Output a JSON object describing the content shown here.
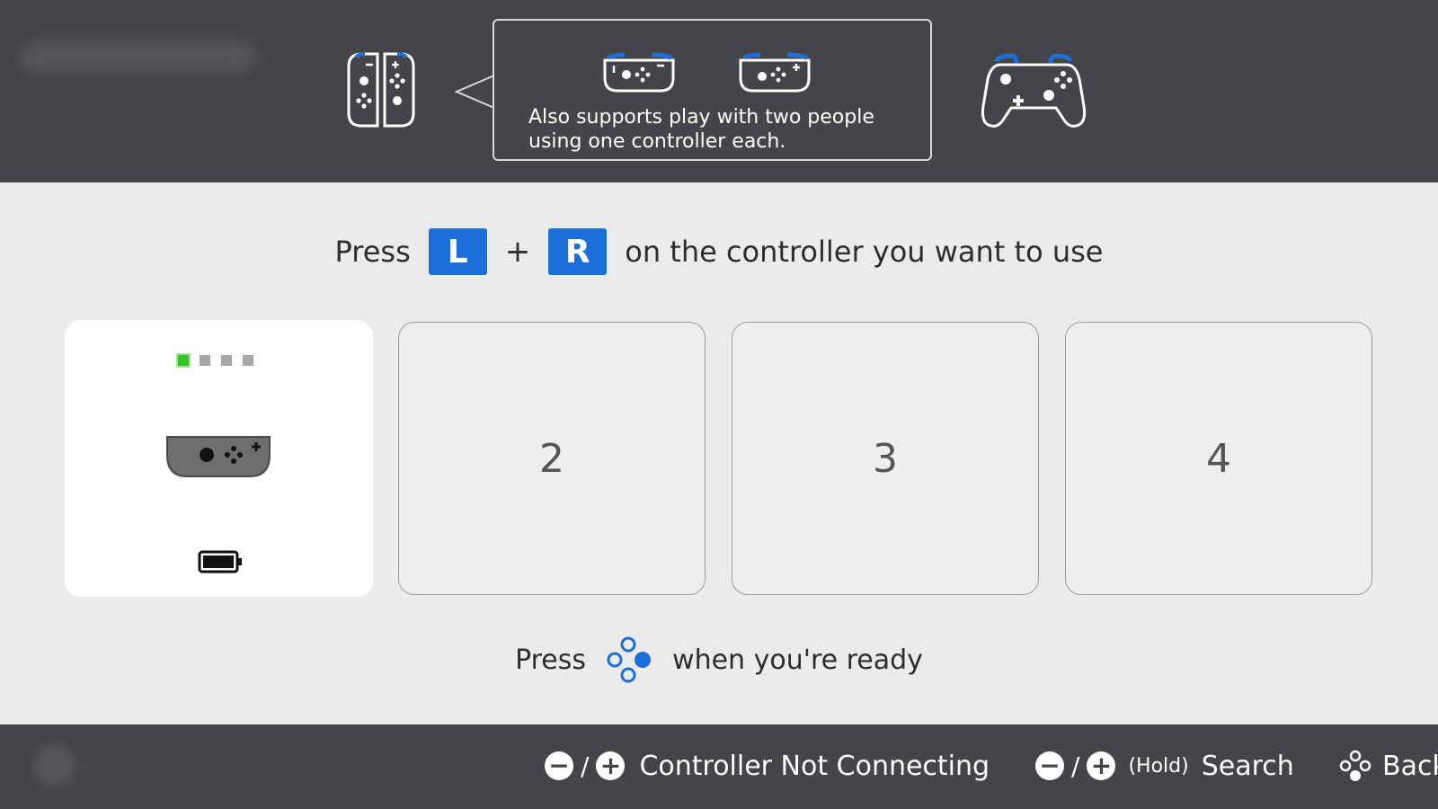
{
  "header": {
    "bubble_text_line1": "Also supports play with two people",
    "bubble_text_line2": "using one controller each."
  },
  "instruction": {
    "press": "Press",
    "key_left": "L",
    "plus": "+",
    "key_right": "R",
    "rest": "on the controller you want to use"
  },
  "slots": {
    "slot2_number": "2",
    "slot3_number": "3",
    "slot4_number": "4",
    "slot1_player_leds_on": 1,
    "slot1_player_leds_total": 4
  },
  "ready": {
    "press": "Press",
    "rest": "when you're ready"
  },
  "footer": {
    "minus": "−",
    "slash": "/",
    "plus": "+",
    "controller_not_connecting": "Controller Not Connecting",
    "hold": "(Hold)",
    "search": "Search",
    "back": "Back"
  },
  "colors": {
    "accent_blue": "#1c6fd8",
    "led_green": "#32c328",
    "bar_gray": "#444548"
  }
}
